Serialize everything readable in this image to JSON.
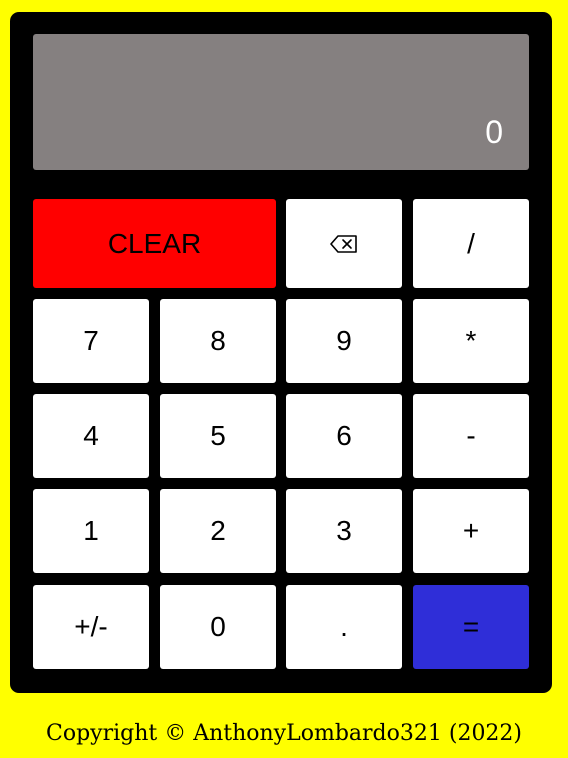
{
  "display": {
    "value": "0"
  },
  "keys": {
    "clear": "CLEAR",
    "backspace_icon": "backspace-icon",
    "divide": "/",
    "seven": "7",
    "eight": "8",
    "nine": "9",
    "multiply": "*",
    "four": "4",
    "five": "5",
    "six": "6",
    "subtract": "-",
    "one": "1",
    "two": "2",
    "three": "3",
    "add": "+",
    "negate": "+/-",
    "zero": "0",
    "decimal": ".",
    "equals": "="
  },
  "footer": {
    "copyright": "Copyright © AnthonyLombardo321 (2022)"
  },
  "colors": {
    "page_background": "#ffff00",
    "calculator_body": "#000000",
    "display_background": "#858080",
    "clear_button": "#ff0000",
    "equals_button": "#2f2ed8",
    "key_background": "#ffffff"
  }
}
